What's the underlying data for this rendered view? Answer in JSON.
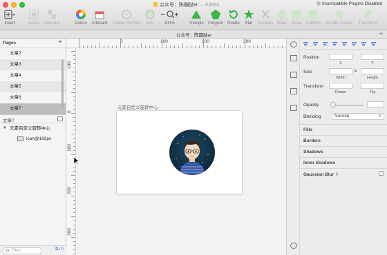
{
  "window": {
    "title": "公众号：陈蹦跶er",
    "status": "— Edited",
    "plugin_warning": "Incompatible Plugins Disabled"
  },
  "toolbar": {
    "insert": "Insert",
    "group": "Group",
    "ungroup": "Ungroup",
    "colors": "Colors",
    "artboard": "Artboard",
    "create_symbol": "Create Symbol",
    "edit": "Edit",
    "zoom": "100%",
    "triangle": "Triangle",
    "polygon": "Polygon",
    "rotate": "Rotate",
    "star": "Star",
    "scissors": "Scissors",
    "mask": "Mask",
    "scale": "Scale",
    "outlines": "Outlines",
    "rotate_copies": "Rotate Copies",
    "transform": "Transform"
  },
  "tab": {
    "title": "公众号：陈蹦跶er",
    "add": "+"
  },
  "pages": {
    "header": "Pages",
    "add": "+",
    "items": [
      "文章2",
      "文章3",
      "文章4",
      "文章5",
      "文章6",
      "文章7"
    ],
    "selected": "文章7"
  },
  "layers": {
    "header": "文章7",
    "artboard": "元素自定义旋转中心",
    "child": "icon@192px"
  },
  "filter": {
    "placeholder": "Filter",
    "count": "0"
  },
  "rulers": {
    "h": [
      "0",
      "100",
      "200",
      "300"
    ],
    "v": [
      "100",
      "0",
      "100",
      "200",
      "300"
    ]
  },
  "canvas": {
    "artboard_name": "元素自定义旋转中心"
  },
  "inspector": {
    "position": "Position",
    "x": "X",
    "y": "Y",
    "size": "Size",
    "width": "Width",
    "height": "Height",
    "transform": "Transform",
    "rotate": "Rotate",
    "flip": "Flip",
    "opacity": "Opacity",
    "blending": "Blending",
    "blending_value": "Normal",
    "fills": "Fills",
    "borders": "Borders",
    "shadows": "Shadows",
    "inner_shadows": "Inner Shadows",
    "gaussian_blur": "Gaussian Blur"
  },
  "colors": {
    "accent": "#3478d8",
    "triangle": "#3bb54a",
    "avatar_bg": "#0f2b3d"
  }
}
